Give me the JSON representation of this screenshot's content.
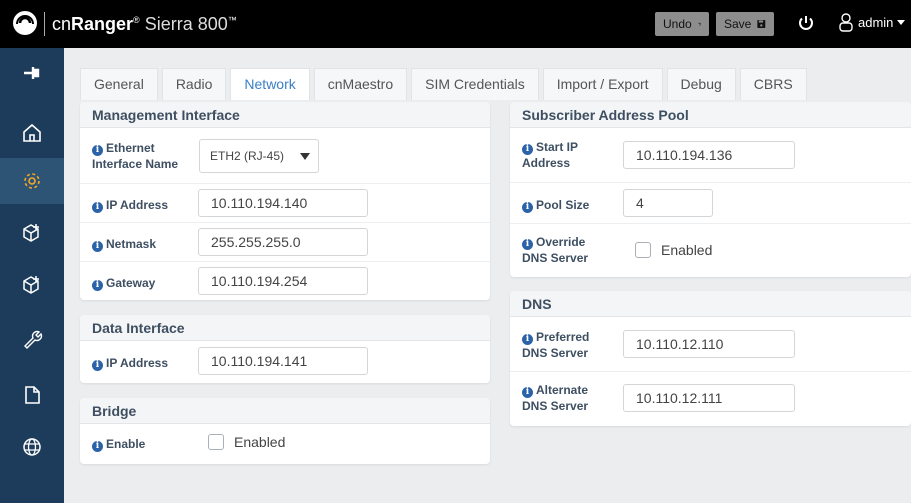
{
  "header": {
    "brand_prefix": "cn",
    "brand_name": "Ranger",
    "brand_reg": "®",
    "model": "Sierra 800",
    "model_tm": "™",
    "undo_label": "Undo",
    "save_label": "Save",
    "user": "admin"
  },
  "sidebar": {
    "items": [
      "pin-icon",
      "home-icon",
      "settings-icon",
      "package-add-icon",
      "package-add-icon",
      "wrench-icon",
      "file-icon",
      "globe-icon"
    ],
    "active_index": 2
  },
  "tabs": [
    "General",
    "Radio",
    "Network",
    "cnMaestro",
    "SIM Credentials",
    "Import / Export",
    "Debug",
    "CBRS"
  ],
  "active_tab": "Network",
  "management": {
    "title": "Management Interface",
    "ethernet_label_1": "Ethernet",
    "ethernet_label_2": "Interface Name",
    "ethernet_value": "ETH2 (RJ-45)",
    "ip_label": "IP Address",
    "ip_value": "10.110.194.140",
    "netmask_label": "Netmask",
    "netmask_value": "255.255.255.0",
    "gateway_label": "Gateway",
    "gateway_value": "10.110.194.254"
  },
  "data_interface": {
    "title": "Data Interface",
    "ip_label": "IP Address",
    "ip_value": "10.110.194.141"
  },
  "bridge": {
    "title": "Bridge",
    "enable_label": "Enable",
    "enabled_text": "Enabled"
  },
  "pool": {
    "title": "Subscriber Address Pool",
    "start_label_1": "Start IP",
    "start_label_2": "Address",
    "start_value": "10.110.194.136",
    "size_label": "Pool Size",
    "size_value": "4",
    "override_label_1": "Override",
    "override_label_2": "DNS Server",
    "enabled_text": "Enabled"
  },
  "dns": {
    "title": "DNS",
    "preferred_label_1": "Preferred",
    "preferred_label_2": "DNS Server",
    "preferred_value": "10.110.12.110",
    "alternate_label_1": "Alternate",
    "alternate_label_2": "DNS Server",
    "alternate_value": "10.110.12.111"
  },
  "info_glyph": "i"
}
